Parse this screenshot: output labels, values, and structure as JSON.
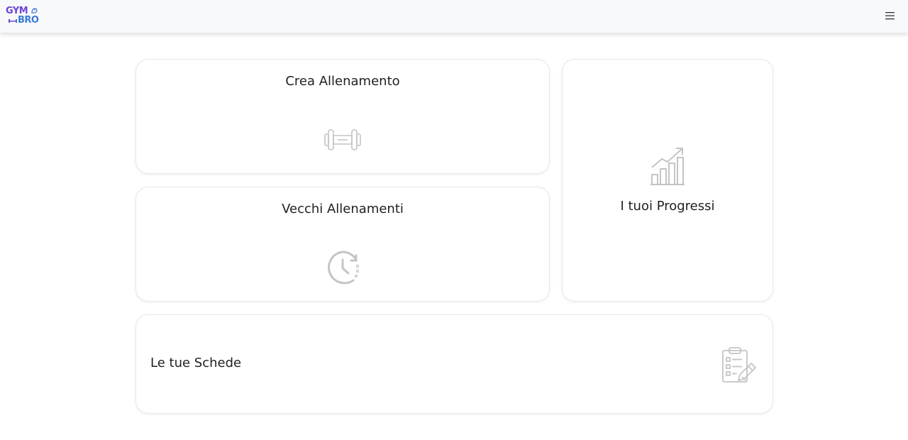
{
  "header": {
    "logo_text_top": "GYM",
    "logo_text_bottom": "BRO",
    "menu_icon": "hamburger-menu-icon"
  },
  "cards": {
    "crea": {
      "title": "Crea Allenamento",
      "icon": "dumbbell-icon"
    },
    "vecchi": {
      "title": "Vecchi Allenamenti",
      "icon": "history-clock-icon"
    },
    "progressi": {
      "title": "I tuoi Progressi",
      "icon": "growth-chart-icon"
    },
    "schede": {
      "title": "Le tue Schede",
      "icon": "clipboard-edit-icon"
    }
  },
  "colors": {
    "logo_purple": "#6c44d8",
    "logo_blue": "#3a7ad9",
    "icon_gray": "#c4c4c4",
    "navbar_bg": "#f8f9fa"
  }
}
